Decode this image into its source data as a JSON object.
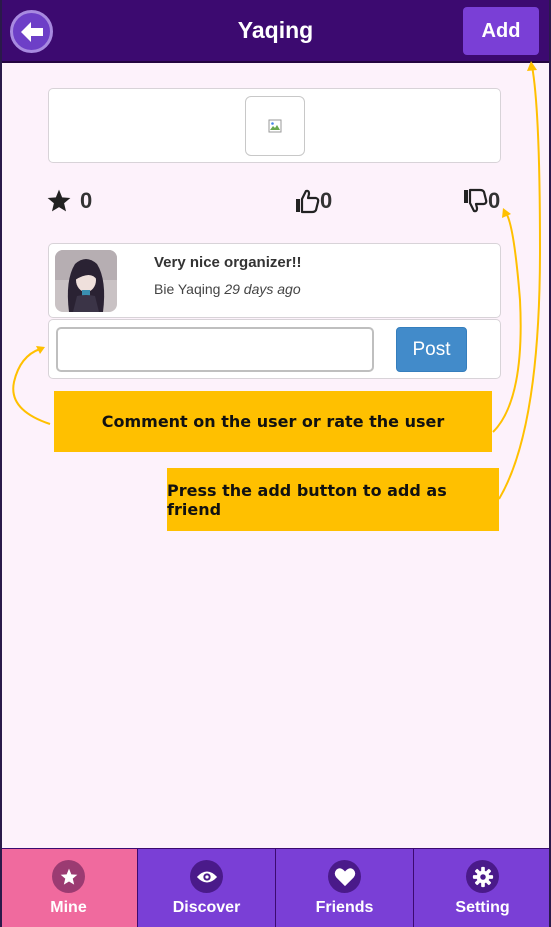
{
  "header": {
    "title": "Yaqing",
    "add_label": "Add",
    "back_icon": "arrow-left-icon"
  },
  "profile": {
    "avatar_icon": "broken-image-icon"
  },
  "stats": {
    "stars": "0",
    "likes": "0",
    "dislikes": "0"
  },
  "comment": {
    "text": "Very nice organizer!!",
    "author": "Bie Yaqing",
    "time": "29 days ago"
  },
  "composer": {
    "input_value": "",
    "post_label": "Post"
  },
  "callouts": {
    "comment_hint": "Comment on the user or rate the user",
    "add_hint": "Press the add button to add as friend"
  },
  "nav": {
    "tabs": [
      {
        "label": "Mine",
        "icon": "star-icon",
        "active": true
      },
      {
        "label": "Discover",
        "icon": "eye-icon",
        "active": false
      },
      {
        "label": "Friends",
        "icon": "heart-icon",
        "active": false
      },
      {
        "label": "Setting",
        "icon": "gear-icon",
        "active": false
      }
    ]
  },
  "colors": {
    "header": "#3c0a70",
    "accent": "#7a3fd6",
    "active_tab": "#f06a9e",
    "callout": "#ffc000",
    "post_button": "#428bca"
  }
}
